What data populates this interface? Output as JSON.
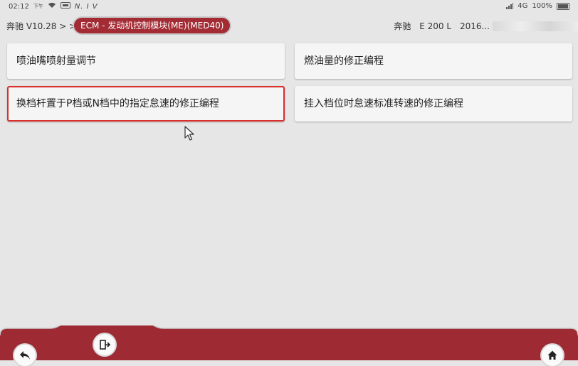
{
  "status_bar": {
    "time": "02:12",
    "am_pm": "下午",
    "extra": "N. I V",
    "network": "4G",
    "battery": "100%"
  },
  "header": {
    "brand_version": "奔驰 V10.28 > >",
    "module_crumb": "ECM - 发动机控制模块(ME)(MED40)",
    "vehicle_brand": "奔驰",
    "vehicle_model": "E 200 L",
    "vehicle_year": "2016..."
  },
  "functions": [
    {
      "label": "喷油嘴喷射量调节",
      "selected": false
    },
    {
      "label": "燃油量的修正编程",
      "selected": false
    },
    {
      "label": "换档杆置于P档或N档中的指定怠速的修正编程",
      "selected": true
    },
    {
      "label": "挂入档位时怠速标准转速的修正编程",
      "selected": false
    }
  ],
  "colors": {
    "accent": "#a32c34",
    "bar": "#9e2a33",
    "selection": "#d9302e",
    "background": "#e6e6e6"
  },
  "bottom_bar": {
    "back_icon": "back-arrow-icon",
    "exit_icon": "exit-door-icon",
    "home_icon": "home-icon"
  }
}
